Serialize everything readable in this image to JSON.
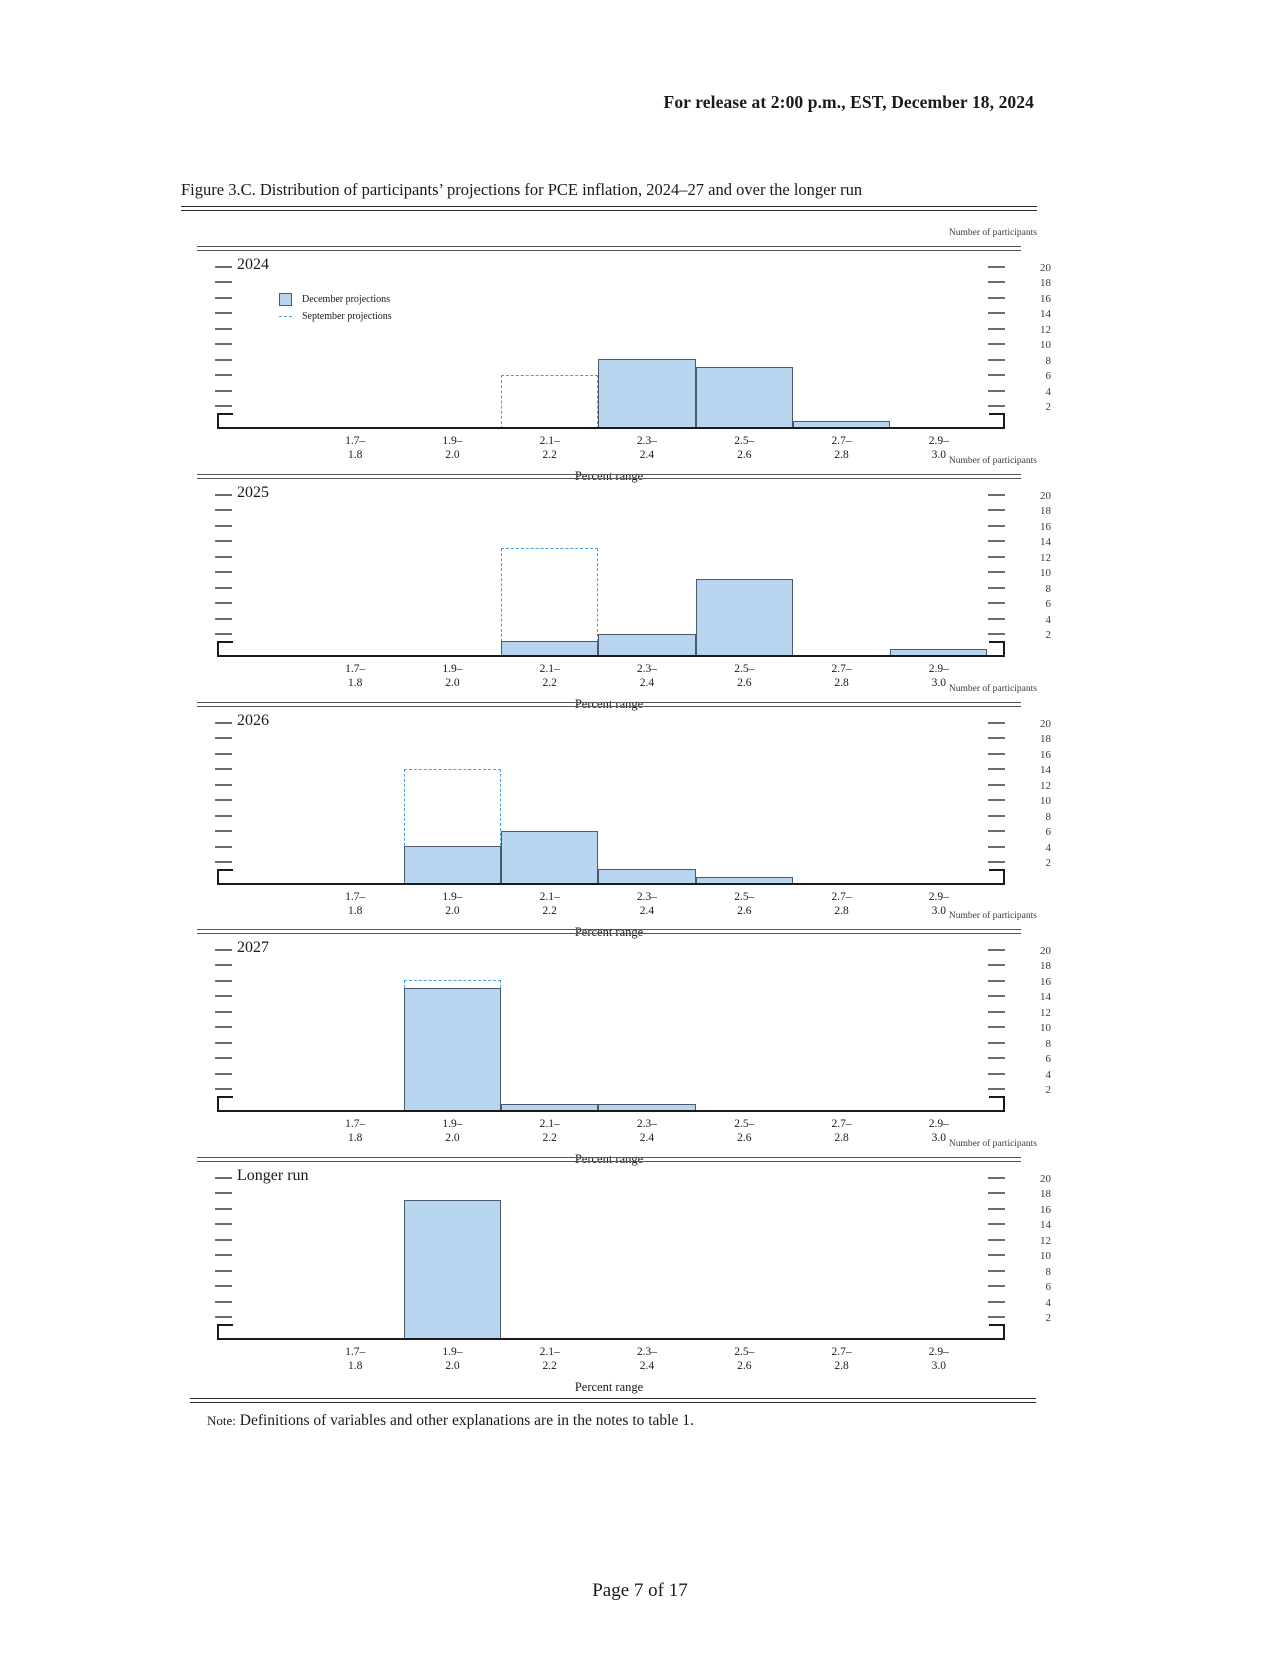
{
  "header": {
    "release_line": "For release at 2:00 p.m., EST, December 18, 2024"
  },
  "figure": {
    "title": "Figure 3.C. Distribution of participants’ projections for PCE inflation, 2024–27 and over the longer run",
    "axis_note": "Number of participants",
    "xaxis_title": "Percent range",
    "legend": {
      "december_label": "December projections",
      "september_label": "September projections"
    },
    "colors": {
      "bar_fill": "#b7d5ef",
      "bar_edge": "#4a5a6a",
      "september_dash": "#49a0d8"
    }
  },
  "footer": {
    "note_prefix": "Note:",
    "note_text": "Definitions of variables and other explanations are in the notes to table 1.",
    "page": "Page 7 of 17"
  },
  "chart_data": {
    "type": "bar",
    "title": "Figure 3.C. Distribution of participants’ projections for PCE inflation, 2024–27 and over the longer run",
    "xlabel": "Percent range",
    "ylabel": "Number of participants",
    "ylim": [
      0,
      21
    ],
    "yticks": [
      20,
      18,
      16,
      14,
      12,
      10,
      8,
      6,
      4,
      2
    ],
    "grid": false,
    "legend_position": "top-left (first panel)",
    "categories": [
      "1.7–\n1.8",
      "1.9–\n2.0",
      "2.1–\n2.2",
      "2.3–\n2.4",
      "2.5–\n2.6",
      "2.7–\n2.8",
      "2.9–\n3.0"
    ],
    "category_lines": [
      [
        "1.7–",
        "1.8"
      ],
      [
        "1.9–",
        "2.0"
      ],
      [
        "2.1–",
        "2.2"
      ],
      [
        "2.3–",
        "2.4"
      ],
      [
        "2.5–",
        "2.6"
      ],
      [
        "2.7–",
        "2.8"
      ],
      [
        "2.9–",
        "3.0"
      ]
    ],
    "panels": [
      {
        "label": "2024",
        "series": [
          {
            "name": "December projections",
            "values": [
              0,
              0,
              0,
              9,
              8,
              1,
              0
            ]
          },
          {
            "name": "September projections",
            "values": [
              0,
              0,
              7,
              8,
              1,
              1,
              0
            ]
          }
        ]
      },
      {
        "label": "2025",
        "series": [
          {
            "name": "December projections",
            "values": [
              0,
              0,
              2,
              3,
              10,
              0,
              1
            ]
          },
          {
            "name": "September projections",
            "values": [
              0,
              0,
              14,
              2,
              0,
              0,
              0
            ]
          }
        ]
      },
      {
        "label": "2026",
        "series": [
          {
            "name": "December projections",
            "values": [
              0,
              5,
              7,
              2,
              1,
              0,
              0
            ]
          },
          {
            "name": "September projections",
            "values": [
              0,
              15,
              2,
              0,
              0,
              0,
              0
            ]
          }
        ]
      },
      {
        "label": "2027",
        "series": [
          {
            "name": "December projections",
            "values": [
              0,
              16,
              1,
              1,
              0,
              0,
              0
            ]
          },
          {
            "name": "September projections",
            "values": [
              0,
              17,
              0,
              0,
              0,
              0,
              0
            ]
          }
        ]
      },
      {
        "label": "Longer run",
        "series": [
          {
            "name": "December projections",
            "values": [
              0,
              18,
              0,
              0,
              0,
              0,
              0
            ]
          },
          {
            "name": "September projections",
            "values": [
              0,
              18,
              0,
              0,
              0,
              0,
              0
            ]
          }
        ]
      }
    ]
  }
}
